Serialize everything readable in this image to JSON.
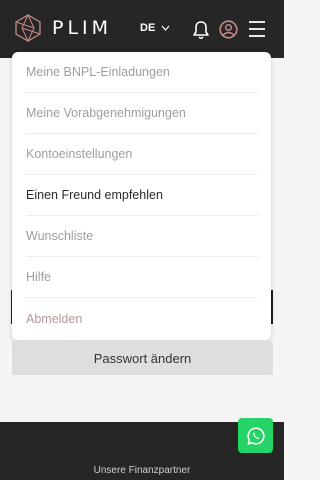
{
  "app": {
    "logo_text": "PLIM"
  },
  "header": {
    "language": "DE",
    "icons": {
      "notifications": "bell-icon",
      "account": "user-icon",
      "menu": "hamburger-icon"
    }
  },
  "menu": {
    "items": [
      {
        "label": "Meine BNPL-Einladungen"
      },
      {
        "label": "Meine Vorabgenehmigungen"
      },
      {
        "label": "Kontoeinstellungen"
      },
      {
        "label": "Einen Freund empfehlen"
      },
      {
        "label": "Wunschliste"
      },
      {
        "label": "Hilfe"
      },
      {
        "label": "Abmelden"
      }
    ]
  },
  "page": {
    "change_password_label": "Passwort ändern"
  },
  "footer": {
    "partners_label": "Unsere Finanzpartner"
  },
  "colors": {
    "topbar": "#262626",
    "accent": "#c98a86",
    "whatsapp": "#25d366"
  }
}
